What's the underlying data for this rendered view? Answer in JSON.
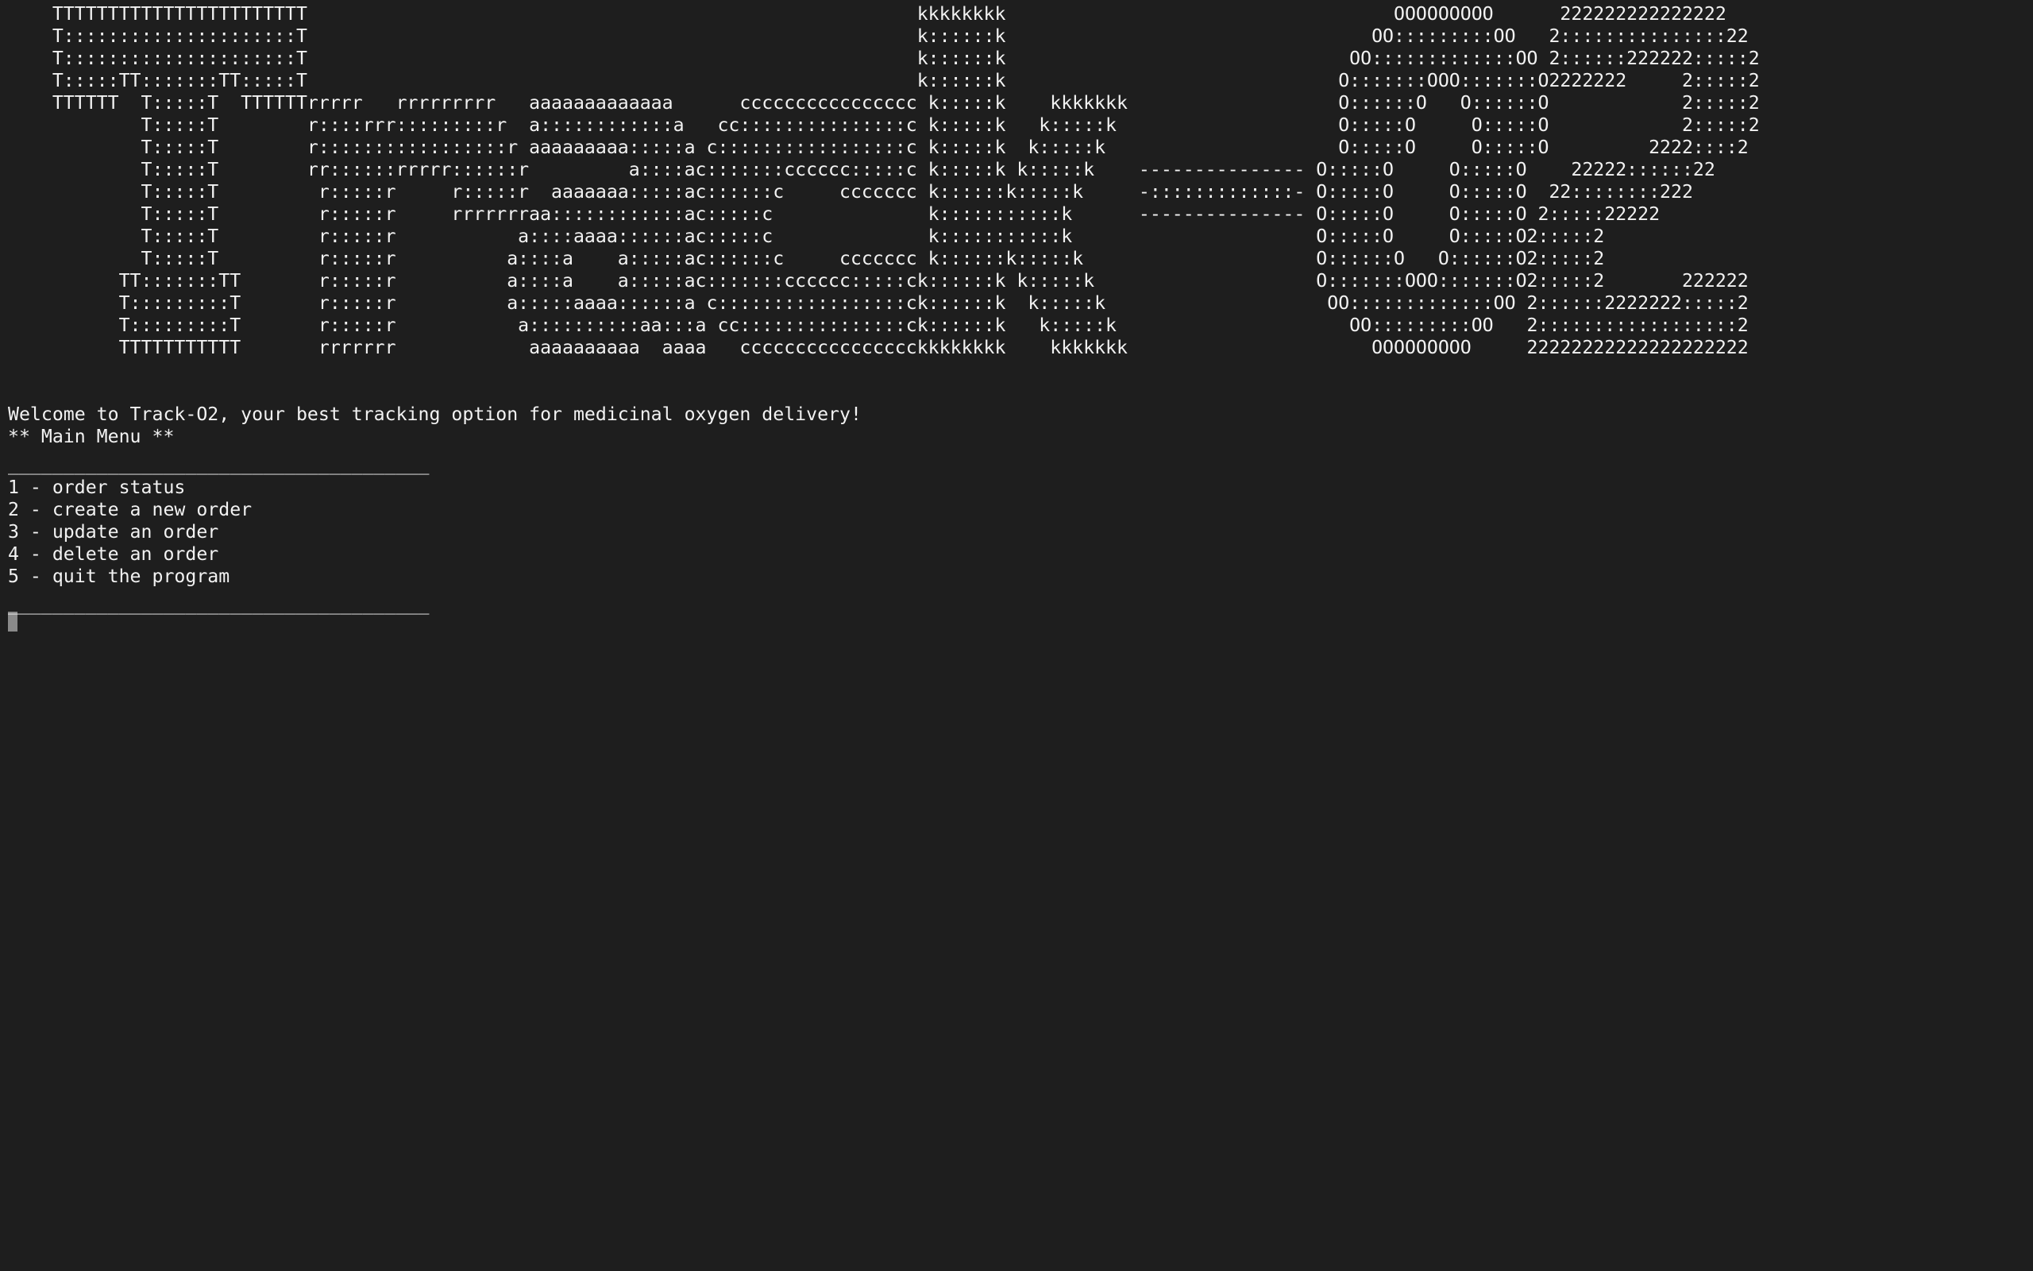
{
  "banner": {
    "lines": [
      "TTTTTTTTTTTTTTTTTTTTTTT                                                       kkkkkkkk                                   OOOOOOOOO      222222222222222",
      "T:::::::::::::::::::::T                                                       k::::::k                                 OO:::::::::OO   2:::::::::::::::22",
      "T:::::::::::::::::::::T                                                       k::::::k                               OO:::::::::::::OO 2::::::222222:::::2",
      "T:::::TT:::::::TT:::::T                                                       k::::::k                              O:::::::OOO:::::::O2222222     2:::::2",
      "TTTTTT  T:::::T  TTTTTTrrrrr   rrrrrrrrr   aaaaaaaaaaaaa      cccccccccccccccc k:::::k    kkkkkkk                   O::::::O   O::::::O            2:::::2",
      "        T:::::T        r::::rrr:::::::::r  a::::::::::::a   cc:::::::::::::::c k:::::k   k:::::k                    O:::::O     O:::::O            2:::::2",
      "        T:::::T        r:::::::::::::::::r aaaaaaaaa:::::a c:::::::::::::::::c k:::::k  k:::::k                     O:::::O     O:::::O         2222::::2",
      "        T:::::T        rr::::::rrrrr::::::r         a::::ac:::::::cccccc:::::c k:::::k k:::::k    --------------- O:::::O     O:::::O    22222::::::22",
      "        T:::::T         r:::::r     r:::::r  aaaaaaa:::::ac::::::c     ccccccc k::::::k:::::k     -:::::::::::::- O:::::O     O:::::O  22::::::::222",
      "        T:::::T         r:::::r     rrrrrrraa::::::::::::ac:::::c              k:::::::::::k      --------------- O:::::O     O:::::O 2:::::22222",
      "        T:::::T         r:::::r           a::::aaaa::::::ac:::::c              k:::::::::::k                      O:::::O     O:::::O2:::::2",
      "        T:::::T         r:::::r          a::::a    a:::::ac::::::c     ccccccc k::::::k:::::k                     O::::::O   O::::::O2:::::2",
      "      TT:::::::TT       r:::::r          a::::a    a:::::ac:::::::cccccc:::::ck::::::k k:::::k                    O:::::::OOO:::::::O2:::::2       222222",
      "      T:::::::::T       r:::::r          a:::::aaaa::::::a c:::::::::::::::::ck::::::k  k:::::k                    OO:::::::::::::OO 2::::::2222222:::::2",
      "      T:::::::::T       r:::::r           a::::::::::aa:::a cc:::::::::::::::ck::::::k   k:::::k                     OO:::::::::OO   2::::::::::::::::::2",
      "      TTTTTTTTTTT       rrrrrrr            aaaaaaaaaa  aaaa   cccccccccccccccckkkkkkkk    kkkkkkk                      OOOOOOOOO     22222222222222222222"
    ]
  },
  "welcome_text": "Welcome to Track-O2, your best tracking option for medicinal oxygen delivery!",
  "menu_title": "** Main Menu **",
  "rule_text": "______________________________________",
  "menu_items": [
    "1 - order status",
    "2 - create a new order",
    "3 - update an order",
    "4 - delete an order",
    "5 - quit the program"
  ],
  "colors": {
    "background": "#1e1e1e",
    "foreground": "#f2f2f2",
    "cursor": "#8a8a8a"
  }
}
